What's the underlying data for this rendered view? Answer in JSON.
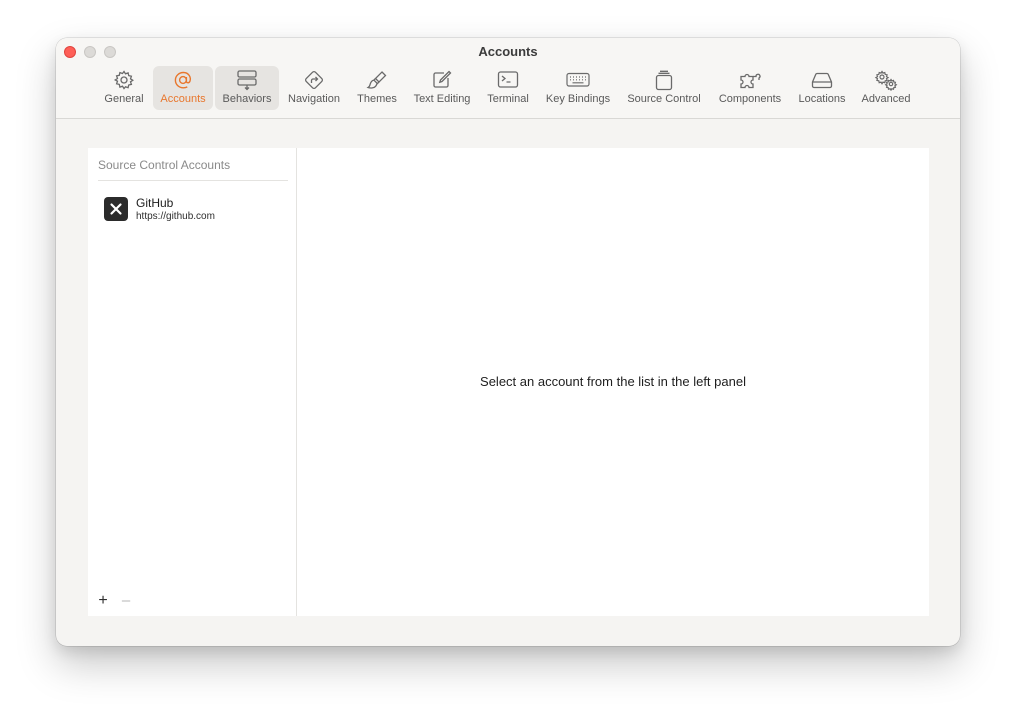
{
  "window": {
    "title": "Accounts"
  },
  "toolbar": {
    "items": [
      {
        "label": "General",
        "icon": "gear-icon"
      },
      {
        "label": "Accounts",
        "icon": "at-sign-icon",
        "selected": true
      },
      {
        "label": "Behaviors",
        "icon": "behaviors-icon"
      },
      {
        "label": "Navigation",
        "icon": "navigation-arrow-icon"
      },
      {
        "label": "Themes",
        "icon": "paintbrush-icon"
      },
      {
        "label": "Text Editing",
        "icon": "pencil-square-icon"
      },
      {
        "label": "Terminal",
        "icon": "terminal-icon"
      },
      {
        "label": "Key Bindings",
        "icon": "keyboard-icon"
      },
      {
        "label": "Source Control",
        "icon": "source-control-icon"
      },
      {
        "label": "Components",
        "icon": "puzzle-icon"
      },
      {
        "label": "Locations",
        "icon": "drive-icon"
      },
      {
        "label": "Advanced",
        "icon": "gears-icon"
      }
    ],
    "accent_color": "#e8772e"
  },
  "sidebar": {
    "header": "Source Control Accounts",
    "accounts": [
      {
        "name": "GitHub",
        "url": "https://github.com",
        "icon": "github-logo-icon"
      }
    ],
    "add_label": "+",
    "remove_label": "–"
  },
  "detail": {
    "message": "Select an account from the list in the left panel"
  }
}
